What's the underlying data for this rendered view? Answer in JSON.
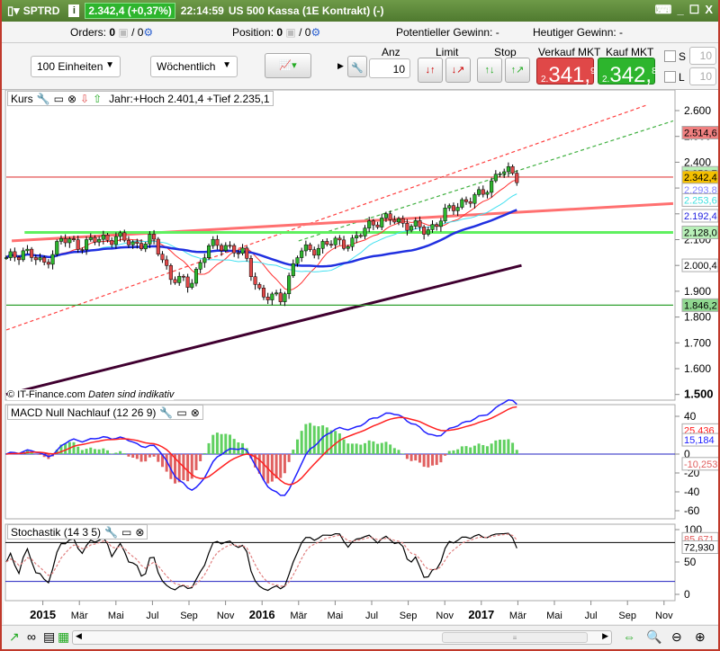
{
  "title": {
    "symbol": "SPTRD",
    "quote": "2.342,4 (+0,37%)",
    "time": "22:14:59",
    "instrument": "US 500 Kassa (1E Kontrakt) (-)"
  },
  "status": {
    "orders_label": "Orders:",
    "orders_value": "0",
    "orders_total": "/ 0",
    "position_label": "Position:",
    "position_value": "0",
    "position_total": "/ 0",
    "pot_gain": "Potentieller Gewinn: -",
    "today_gain": "Heutiger Gewinn: -"
  },
  "toolbar": {
    "units": "100 Einheiten",
    "period": "Wöchentlich",
    "anz_label": "Anz",
    "anz_value": "10",
    "limit_label": "Limit",
    "stop_label": "Stop",
    "sell_label": "Verkauf MKT",
    "buy_label": "Kauf MKT",
    "sell_prefix": "2.",
    "sell_main": "341,",
    "sell_frac": "9",
    "buy_prefix": "2.",
    "buy_main": "342,",
    "buy_frac": "8",
    "s_label": "S",
    "s_value": "10",
    "l_label": "L",
    "l_value": "10"
  },
  "colors": {
    "accent": "#5a8a3a",
    "sell": "#e04848",
    "buy": "#2db52d",
    "up": "#2db52d",
    "down": "#e04848"
  },
  "panels": {
    "kurs": {
      "title": "Kurs",
      "year_info": "Jahr:+Hoch 2.401,4 +Tief 2.235,1",
      "copyright": "© IT-Finance.com",
      "disclaimer": "Daten sind indikativ"
    },
    "macd": {
      "title": "MACD Null Nachlauf (12 26 9)"
    },
    "stoch": {
      "title": "Stochastik (14 3 5)"
    }
  },
  "chart_data": {
    "type": "candlestick",
    "y_ticks": [
      "2.600",
      "2.500",
      "2.400",
      "2.300",
      "2.200",
      "2.100",
      "2.000",
      "1.900",
      "1.800",
      "1.700",
      "1.600",
      "1.500"
    ],
    "y_tick_values": [
      2600,
      2500,
      2400,
      2300,
      2200,
      2100,
      2000,
      1900,
      1800,
      1700,
      1600,
      1500
    ],
    "x_labels": [
      "2015",
      "Mär",
      "Mai",
      "Jul",
      "Sep",
      "Nov",
      "2016",
      "Mär",
      "Mai",
      "Jul",
      "Sep",
      "Nov",
      "2017",
      "Mär",
      "Mai",
      "Jul",
      "Sep",
      "Nov"
    ],
    "x_label_months": [
      24,
      26,
      28,
      30,
      32,
      34,
      36,
      38,
      40,
      42,
      44,
      46,
      48,
      50,
      52,
      54,
      56,
      58
    ],
    "monthly_closes_from_nov_2014": [
      2020,
      2060,
      2000,
      2100,
      2080,
      2100,
      2110,
      2080,
      2100,
      1960,
      1920,
      2070,
      2080,
      2040,
      1880,
      1870,
      2050,
      2070,
      2090,
      2090,
      2170,
      2180,
      2160,
      2130,
      2200,
      2250,
      2270,
      2370,
      2342
    ],
    "price_labels": [
      {
        "text": "2.514,6",
        "value": 2514.6,
        "bg": "#f08080",
        "fg": "#000"
      },
      {
        "text": "2.358,7",
        "value": 2358.7,
        "bg": "#b8f0b8",
        "fg": "#000"
      },
      {
        "text": "2.342,4",
        "value": 2342.4,
        "bg": "#f5c000",
        "fg": "#000"
      },
      {
        "text": "2.293,8",
        "value": 2293.8,
        "bg": "#fff",
        "fg": "#8080ff"
      },
      {
        "text": "2.253,6",
        "value": 2253.6,
        "bg": "#fff",
        "fg": "#40e0e0"
      },
      {
        "text": "2.192,4",
        "value": 2192.4,
        "bg": "#fff",
        "fg": "#2020e0"
      },
      {
        "text": "2.128,0",
        "value": 2128.0,
        "bg": "#b8f0b8",
        "fg": "#000"
      },
      {
        "text": "2.000,4",
        "value": 2000.4,
        "bg": "#fff",
        "fg": "#000"
      },
      {
        "text": "1.846,2",
        "value": 1846.2,
        "bg": "#90d890",
        "fg": "#000"
      }
    ],
    "trendlines": [
      {
        "name": "upper-red-dashed",
        "color": "#ff4040",
        "dash": true,
        "from": [
          0,
          1750
        ],
        "to": [
          35,
          2620
        ]
      },
      {
        "name": "green-dashed",
        "color": "#40b040",
        "dash": true,
        "from": [
          16,
          2095
        ],
        "to": [
          36.5,
          2560
        ]
      },
      {
        "name": "salmon-trend",
        "color": "#ff7070",
        "dash": false,
        "from": [
          0.3,
          2095
        ],
        "to": [
          36.5,
          2240
        ]
      },
      {
        "name": "purple-ma200",
        "color": "#400030",
        "dash": false,
        "from": [
          0,
          1500
        ],
        "to": [
          28.2,
          2000
        ]
      },
      {
        "name": "resistance-2128",
        "color": "#60f060",
        "dash": false,
        "from": [
          1,
          2128
        ],
        "to": [
          36.5,
          2128
        ]
      },
      {
        "name": "support-1846",
        "color": "#30a030",
        "dash": false,
        "from": [
          0,
          1846.2
        ],
        "to": [
          36.5,
          1846.2
        ]
      },
      {
        "name": "current-2342",
        "color": "#e04040",
        "dash": false,
        "from": [
          0,
          2342.4
        ],
        "to": [
          36.5,
          2342.4
        ]
      }
    ],
    "macd_ticks": [
      "40",
      "0",
      "-20",
      "-40",
      "-60"
    ],
    "macd_tick_values": [
      40,
      0,
      -20,
      -40,
      -60
    ],
    "macd_labels": [
      {
        "text": "25,436",
        "value": 25.4,
        "fg": "#ff2020"
      },
      {
        "text": "15,184",
        "value": 15.2,
        "fg": "#2020ff"
      },
      {
        "text": "-10,253",
        "value": -10.3,
        "fg": "#e06060"
      }
    ],
    "stoch_ticks": [
      "100",
      "50",
      "0"
    ],
    "stoch_tick_values": [
      100,
      50,
      0
    ],
    "stoch_labels": [
      {
        "text": "85,671",
        "value": 85.7,
        "fg": "#e06060"
      },
      {
        "text": "72,930",
        "value": 72.9,
        "fg": "#000"
      }
    ]
  }
}
